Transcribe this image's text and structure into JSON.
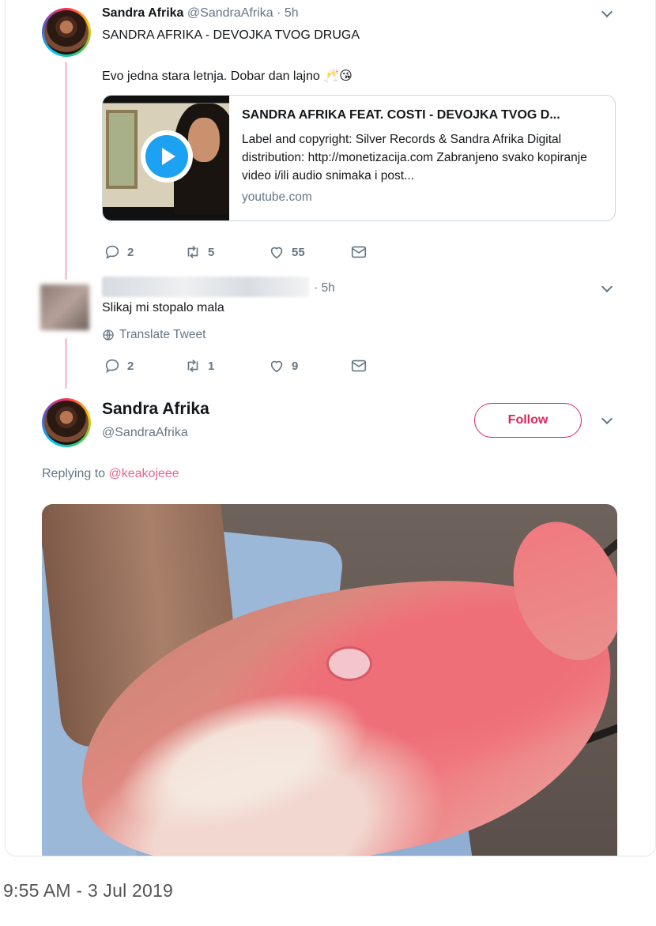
{
  "tweet1": {
    "name": "Sandra Afrika",
    "handle": "@SandraAfrika · 5h",
    "line1": "SANDRA AFRIKA - DEVOJKA TVOG DRUGA",
    "line2": "Evo jedna stara letnja. Dobar dan lajno 🥂😘",
    "card": {
      "title": "SANDRA AFRIKA FEAT. COSTI - DEVOJKA TVOG D...",
      "description": "Label and copyright: Silver Records & Sandra Afrika Digital distribution: http://monetizacija.com Zabranjeno svako kopiranje video i/ili audio snimaka i post...",
      "domain": "youtube.com"
    },
    "replies": "2",
    "retweets": "5",
    "likes": "55"
  },
  "tweet2": {
    "time": "· 5h",
    "text": "Slikaj mi stopalo mala",
    "translate": "Translate Tweet",
    "replies": "2",
    "retweets": "1",
    "likes": "9"
  },
  "tweet3": {
    "name": "Sandra Afrika",
    "handle": "@SandraAfrika",
    "follow_label": "Follow",
    "replying_prefix": "Replying to ",
    "replying_mention": "@keakojeee"
  },
  "footer": {
    "timestamp": "9:55 AM - 3 Jul 2019"
  },
  "icons": {
    "reply": "reply-icon",
    "retweet": "retweet-icon",
    "like": "heart-icon",
    "message": "envelope-icon",
    "chevron": "chevron-down-icon",
    "globe": "globe-icon",
    "play": "play-icon"
  },
  "colors": {
    "accent": "#e0245e",
    "muted": "#657786",
    "link_blue": "#1da1f2",
    "thread_line": "#f7c7d8"
  }
}
